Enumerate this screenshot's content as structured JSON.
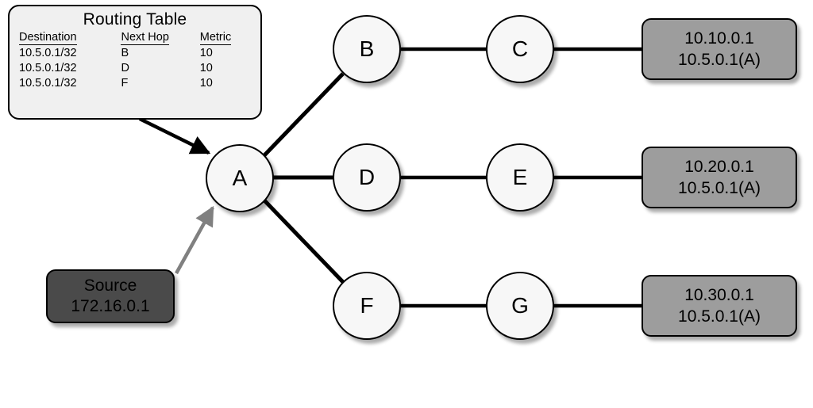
{
  "routing_table": {
    "title": "Routing Table",
    "columns": [
      "Destination",
      "Next Hop",
      "Metric"
    ],
    "rows": [
      {
        "destination": "10.5.0.1/32",
        "next_hop": "B",
        "metric": "10"
      },
      {
        "destination": "10.5.0.1/32",
        "next_hop": "D",
        "metric": "10"
      },
      {
        "destination": "10.5.0.1/32",
        "next_hop": "F",
        "metric": "10"
      }
    ]
  },
  "source": {
    "label": "Source",
    "address": "172.16.0.1"
  },
  "nodes": [
    {
      "id": "A",
      "label": "A"
    },
    {
      "id": "B",
      "label": "B"
    },
    {
      "id": "C",
      "label": "C"
    },
    {
      "id": "D",
      "label": "D"
    },
    {
      "id": "E",
      "label": "E"
    },
    {
      "id": "F",
      "label": "F"
    },
    {
      "id": "G",
      "label": "G"
    }
  ],
  "destinations": [
    {
      "id": "top",
      "primary": "10.10.0.1",
      "anycast": "10.5.0.1(A)"
    },
    {
      "id": "middle",
      "primary": "10.20.0.1",
      "anycast": "10.5.0.1(A)"
    },
    {
      "id": "bottom",
      "primary": "10.30.0.1",
      "anycast": "10.5.0.1(A)"
    }
  ],
  "colors": {
    "node_fill": "#f7f7f7",
    "destination_fill": "#9d9d9d",
    "source_fill": "#4a4a4a",
    "table_fill": "#f0f0f0",
    "stroke": "#000000",
    "source_arrow": "#808080"
  }
}
